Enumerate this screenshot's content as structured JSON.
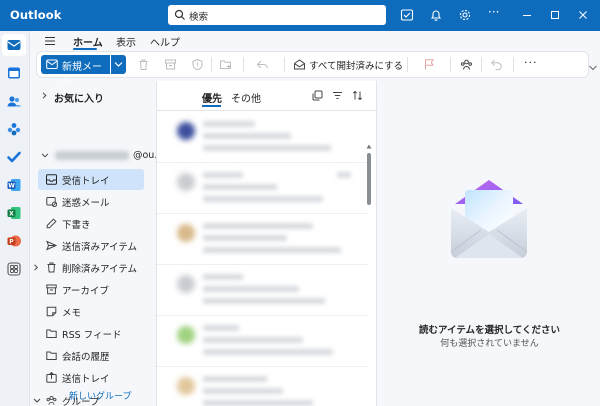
{
  "app": {
    "title": "Outlook"
  },
  "search": {
    "placeholder": "検索"
  },
  "tabs": [
    {
      "label": "ホーム",
      "active": true
    },
    {
      "label": "表示",
      "active": false
    },
    {
      "label": "ヘルプ",
      "active": false
    }
  ],
  "ribbon": {
    "new_mail_label": "新規メール",
    "mark_all_read_label": "すべて開封済みにする",
    "more_label": "···"
  },
  "folders": {
    "favorites_label": "お気に入り",
    "account_suffix": "@ou...",
    "items": [
      {
        "label": "受信トレイ",
        "icon": "inbox-icon",
        "selected": true
      },
      {
        "label": "迷惑メール",
        "icon": "junk-icon",
        "selected": false
      },
      {
        "label": "下書き",
        "icon": "pencil-icon",
        "selected": false
      },
      {
        "label": "送信済みアイテム",
        "icon": "send-icon",
        "selected": false
      },
      {
        "label": "削除済みアイテム",
        "icon": "trash-icon",
        "selected": false
      },
      {
        "label": "アーカイブ",
        "icon": "archive-icon",
        "selected": false
      },
      {
        "label": "メモ",
        "icon": "note-icon",
        "selected": false
      },
      {
        "label": "RSS フィード",
        "icon": "folder-icon",
        "selected": false
      },
      {
        "label": "会話の履歴",
        "icon": "folder-icon",
        "selected": false
      },
      {
        "label": "送信トレイ",
        "icon": "outbox-icon",
        "selected": false
      },
      {
        "label": "グループ",
        "icon": "group-icon",
        "selected": false
      }
    ],
    "new_group_label": "新しいグループ"
  },
  "message_list": {
    "tabs": [
      {
        "label": "優先",
        "active": true
      },
      {
        "label": "その他",
        "active": false
      }
    ]
  },
  "reading_pane": {
    "title": "読むアイテムを選択してください",
    "subtitle": "何も選択されていません"
  },
  "colors": {
    "accent": "#0f6cbd",
    "selected_folder_bg": "#cfe4fa"
  }
}
